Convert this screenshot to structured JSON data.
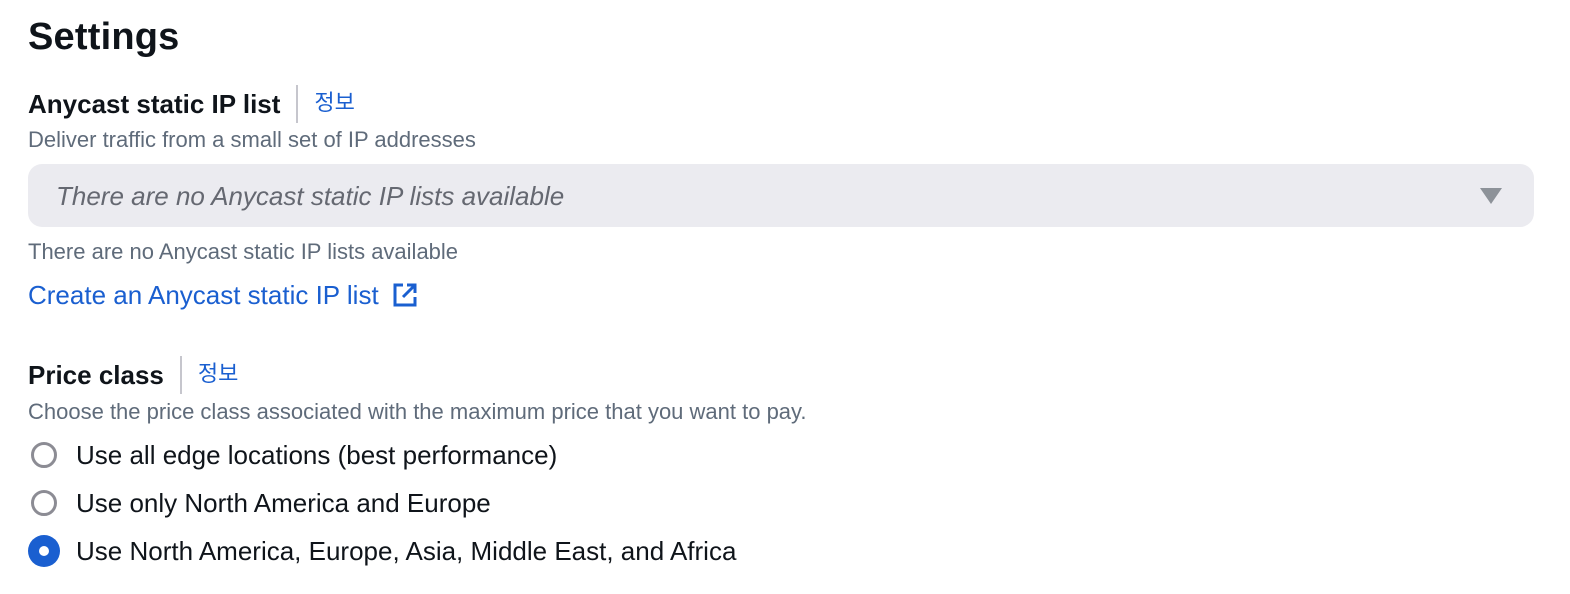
{
  "settings": {
    "title": "Settings"
  },
  "anycast": {
    "label": "Anycast static IP list",
    "info_link": "정보",
    "description": "Deliver traffic from a small set of IP addresses",
    "select_placeholder": "There are no Anycast static IP lists available",
    "helper_text": "There are no Anycast static IP lists available",
    "create_link": "Create an Anycast static IP list",
    "create_link_icon": "external-link-icon"
  },
  "price_class": {
    "label": "Price class",
    "info_link": "정보",
    "description": "Choose the price class associated with the maximum price that you want to pay.",
    "selected_index": 2,
    "options": [
      {
        "label": "Use all edge locations (best performance)",
        "selected": false
      },
      {
        "label": "Use only North America and Europe",
        "selected": false
      },
      {
        "label": "Use North America, Europe, Asia, Middle East, and Africa",
        "selected": true
      }
    ]
  },
  "colors": {
    "link": "#1a5fd0",
    "radio_selected": "#1a5fd0",
    "select_background": "#ebebf0",
    "description_text": "#5f6b7a"
  }
}
